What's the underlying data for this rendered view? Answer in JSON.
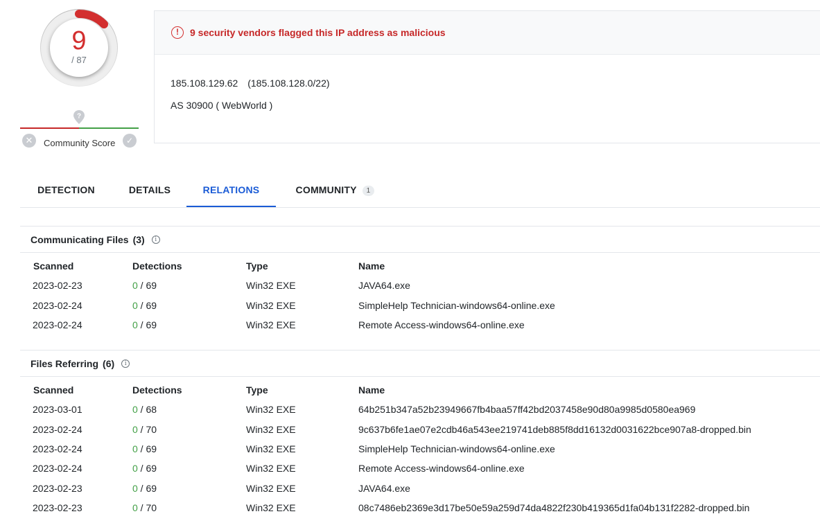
{
  "score": {
    "detections": "9",
    "total": "/ 87",
    "community_label": "Community Score"
  },
  "alert": {
    "text": "9 security vendors flagged this IP address as malicious"
  },
  "ip": {
    "address": "185.108.129.62",
    "network": "(185.108.128.0/22)",
    "as_line": "AS 30900 ( WebWorld )"
  },
  "tabs": [
    {
      "label": "DETECTION",
      "active": false
    },
    {
      "label": "DETAILS",
      "active": false
    },
    {
      "label": "RELATIONS",
      "active": true
    },
    {
      "label": "COMMUNITY",
      "active": false,
      "badge": "1"
    }
  ],
  "columns": {
    "scanned": "Scanned",
    "detections": "Detections",
    "type": "Type",
    "name": "Name"
  },
  "communicating_files": {
    "title": "Communicating Files",
    "count": "(3)",
    "rows": [
      {
        "scanned": "2023-02-23",
        "pos": "0",
        "total": " / 69",
        "type": "Win32 EXE",
        "name": "JAVA64.exe"
      },
      {
        "scanned": "2023-02-24",
        "pos": "0",
        "total": " / 69",
        "type": "Win32 EXE",
        "name": "SimpleHelp Technician-windows64-online.exe"
      },
      {
        "scanned": "2023-02-24",
        "pos": "0",
        "total": " / 69",
        "type": "Win32 EXE",
        "name": "Remote Access-windows64-online.exe"
      }
    ]
  },
  "files_referring": {
    "title": "Files Referring",
    "count": "(6)",
    "rows": [
      {
        "scanned": "2023-03-01",
        "pos": "0",
        "total": " / 68",
        "type": "Win32 EXE",
        "name": "64b251b347a52b23949667fb4baa57ff42bd2037458e90d80a9985d0580ea969"
      },
      {
        "scanned": "2023-02-24",
        "pos": "0",
        "total": " / 70",
        "type": "Win32 EXE",
        "name": "9c637b6fe1ae07e2cdb46a543ee219741deb885f8dd16132d0031622bce907a8-dropped.bin"
      },
      {
        "scanned": "2023-02-24",
        "pos": "0",
        "total": " / 69",
        "type": "Win32 EXE",
        "name": "SimpleHelp Technician-windows64-online.exe"
      },
      {
        "scanned": "2023-02-24",
        "pos": "0",
        "total": " / 69",
        "type": "Win32 EXE",
        "name": "Remote Access-windows64-online.exe"
      },
      {
        "scanned": "2023-02-23",
        "pos": "0",
        "total": " / 69",
        "type": "Win32 EXE",
        "name": "JAVA64.exe"
      },
      {
        "scanned": "2023-02-23",
        "pos": "0",
        "total": " / 70",
        "type": "Win32 EXE",
        "name": "08c7486eb2369e3d17be50e59a259d74da4822f230b419365d1fa04b131f2282-dropped.bin"
      }
    ]
  },
  "colors": {
    "malicious": "#d32f2f",
    "accent": "#1a5bd6",
    "clean": "#43a047"
  },
  "icons": {
    "alert": "exclamation-circle-icon",
    "community": "map-pin-question-icon",
    "vote_down": "x-circle-icon",
    "vote_up": "check-circle-icon",
    "info": "info-circle-icon"
  }
}
